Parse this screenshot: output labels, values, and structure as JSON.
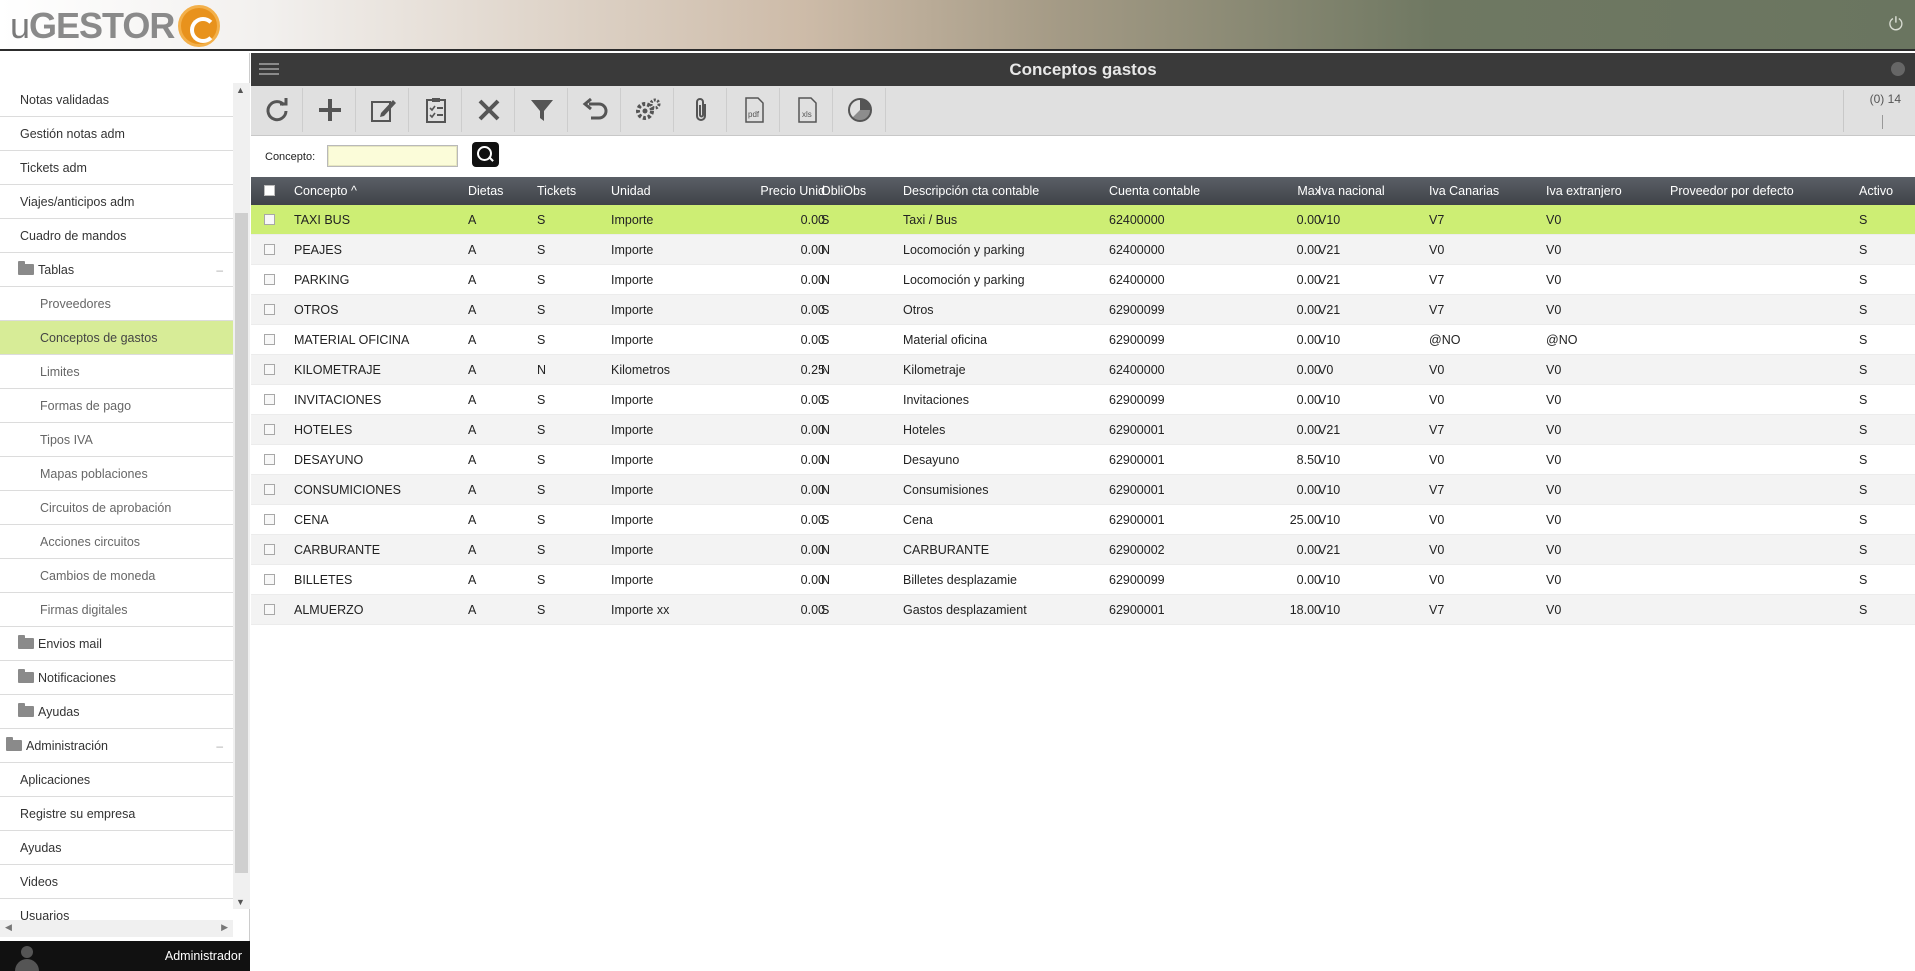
{
  "brand": {
    "logo_u": "u",
    "logo_rest": "GESTOR"
  },
  "user": {
    "name": "Administrador"
  },
  "sidebar": {
    "items": [
      {
        "label": "Notas validadas",
        "type": "item"
      },
      {
        "label": "Gestión notas adm",
        "type": "item"
      },
      {
        "label": "Tickets adm",
        "type": "item"
      },
      {
        "label": "Viajes/anticipos adm",
        "type": "item"
      },
      {
        "label": "Cuadro de mandos",
        "type": "item"
      },
      {
        "label": "Tablas",
        "type": "folder",
        "collapse": "–"
      },
      {
        "label": "Proveedores",
        "type": "sub"
      },
      {
        "label": "Conceptos de gastos",
        "type": "sub",
        "active": true
      },
      {
        "label": "Limites",
        "type": "sub"
      },
      {
        "label": "Formas de pago",
        "type": "sub"
      },
      {
        "label": "Tipos IVA",
        "type": "sub"
      },
      {
        "label": "Mapas poblaciones",
        "type": "sub"
      },
      {
        "label": "Circuitos de aprobación",
        "type": "sub"
      },
      {
        "label": "Acciones circuitos",
        "type": "sub"
      },
      {
        "label": "Cambios de moneda",
        "type": "sub"
      },
      {
        "label": "Firmas digitales",
        "type": "sub"
      },
      {
        "label": "Envios mail",
        "type": "folder"
      },
      {
        "label": "Notificaciones",
        "type": "folder"
      },
      {
        "label": "Ayudas",
        "type": "folder"
      },
      {
        "label": "Administración",
        "type": "top",
        "collapse": "–"
      },
      {
        "label": "Aplicaciones",
        "type": "item"
      },
      {
        "label": "Registre su empresa",
        "type": "item"
      },
      {
        "label": "Ayudas",
        "type": "item"
      },
      {
        "label": "Videos",
        "type": "item"
      },
      {
        "label": "Usuarios",
        "type": "item"
      }
    ]
  },
  "panel": {
    "title": "Conceptos gastos",
    "pager_count": "(0) 14"
  },
  "toolbar": {
    "buttons": [
      {
        "name": "refresh-icon"
      },
      {
        "name": "add-icon"
      },
      {
        "name": "edit-icon"
      },
      {
        "name": "checklist-icon"
      },
      {
        "name": "delete-icon"
      },
      {
        "name": "filter-icon"
      },
      {
        "name": "undo-icon"
      },
      {
        "name": "settings-icon"
      },
      {
        "name": "attach-icon"
      },
      {
        "name": "pdf-icon",
        "text": "pdf"
      },
      {
        "name": "xls-icon",
        "text": "xls"
      },
      {
        "name": "pie-chart-icon"
      }
    ]
  },
  "filter": {
    "label": "Concepto:",
    "value": ""
  },
  "grid": {
    "columns": [
      "Concepto ^",
      "Dietas",
      "Tickets",
      "Unidad",
      "Precio Unid",
      "ObliObs",
      "Descripción cta contable",
      "Cuenta contable",
      "Max",
      "Iva nacional",
      "Iva Canarias",
      "Iva extranjero",
      "Proveedor por defecto",
      "Activo"
    ],
    "rows": [
      [
        "TAXI BUS",
        "A",
        "S",
        "Importe",
        "0.00",
        "S",
        "Taxi / Bus",
        "62400000",
        "0.00",
        "V10",
        "V7",
        "V0",
        "",
        "S"
      ],
      [
        "PEAJES",
        "A",
        "S",
        "Importe",
        "0.00",
        "N",
        "Locomoción y parking",
        "62400000",
        "0.00",
        "V21",
        "V0",
        "V0",
        "",
        "S"
      ],
      [
        "PARKING",
        "A",
        "S",
        "Importe",
        "0.00",
        "N",
        "Locomoción y parking",
        "62400000",
        "0.00",
        "V21",
        "V7",
        "V0",
        "",
        "S"
      ],
      [
        "OTROS",
        "A",
        "S",
        "Importe",
        "0.00",
        "S",
        "Otros",
        "62900099",
        "0.00",
        "V21",
        "V7",
        "V0",
        "",
        "S"
      ],
      [
        "MATERIAL OFICINA",
        "A",
        "S",
        "Importe",
        "0.00",
        "S",
        "Material oficina",
        "62900099",
        "0.00",
        "V10",
        "@NO",
        "@NO",
        "",
        "S"
      ],
      [
        "KILOMETRAJE",
        "A",
        "N",
        "Kilometros",
        "0.25",
        "N",
        "Kilometraje",
        "62400000",
        "0.00",
        "V0",
        "V0",
        "V0",
        "",
        "S"
      ],
      [
        "INVITACIONES",
        "A",
        "S",
        "Importe",
        "0.00",
        "S",
        "Invitaciones",
        "62900099",
        "0.00",
        "V10",
        "V0",
        "V0",
        "",
        "S"
      ],
      [
        "HOTELES",
        "A",
        "S",
        "Importe",
        "0.00",
        "N",
        "Hoteles",
        "62900001",
        "0.00",
        "V21",
        "V7",
        "V0",
        "",
        "S"
      ],
      [
        "DESAYUNO",
        "A",
        "S",
        "Importe",
        "0.00",
        "N",
        "Desayuno",
        "62900001",
        "8.50",
        "V10",
        "V0",
        "V0",
        "",
        "S"
      ],
      [
        "CONSUMICIONES",
        "A",
        "S",
        "Importe",
        "0.00",
        "N",
        "Consumisiones",
        "62900001",
        "0.00",
        "V10",
        "V7",
        "V0",
        "",
        "S"
      ],
      [
        "CENA",
        "A",
        "S",
        "Importe",
        "0.00",
        "S",
        "Cena",
        "62900001",
        "25.00",
        "V10",
        "V0",
        "V0",
        "",
        "S"
      ],
      [
        "CARBURANTE",
        "A",
        "S",
        "Importe",
        "0.00",
        "N",
        "CARBURANTE",
        "62900002",
        "0.00",
        "V21",
        "V0",
        "V0",
        "",
        "S"
      ],
      [
        "BILLETES",
        "A",
        "S",
        "Importe",
        "0.00",
        "N",
        "Billetes desplazamie",
        "62900099",
        "0.00",
        "V10",
        "V0",
        "V0",
        "",
        "S"
      ],
      [
        "ALMUERZO",
        "A",
        "S",
        "Importe xx",
        "0.00",
        "S",
        "Gastos desplazamient",
        "62900001",
        "18.00",
        "V10",
        "V7",
        "V0",
        "",
        "S"
      ]
    ]
  },
  "colors": {
    "selected_row": "#cdee74",
    "active_menu": "#d7ec97",
    "accent_logo": "#e8921c"
  }
}
